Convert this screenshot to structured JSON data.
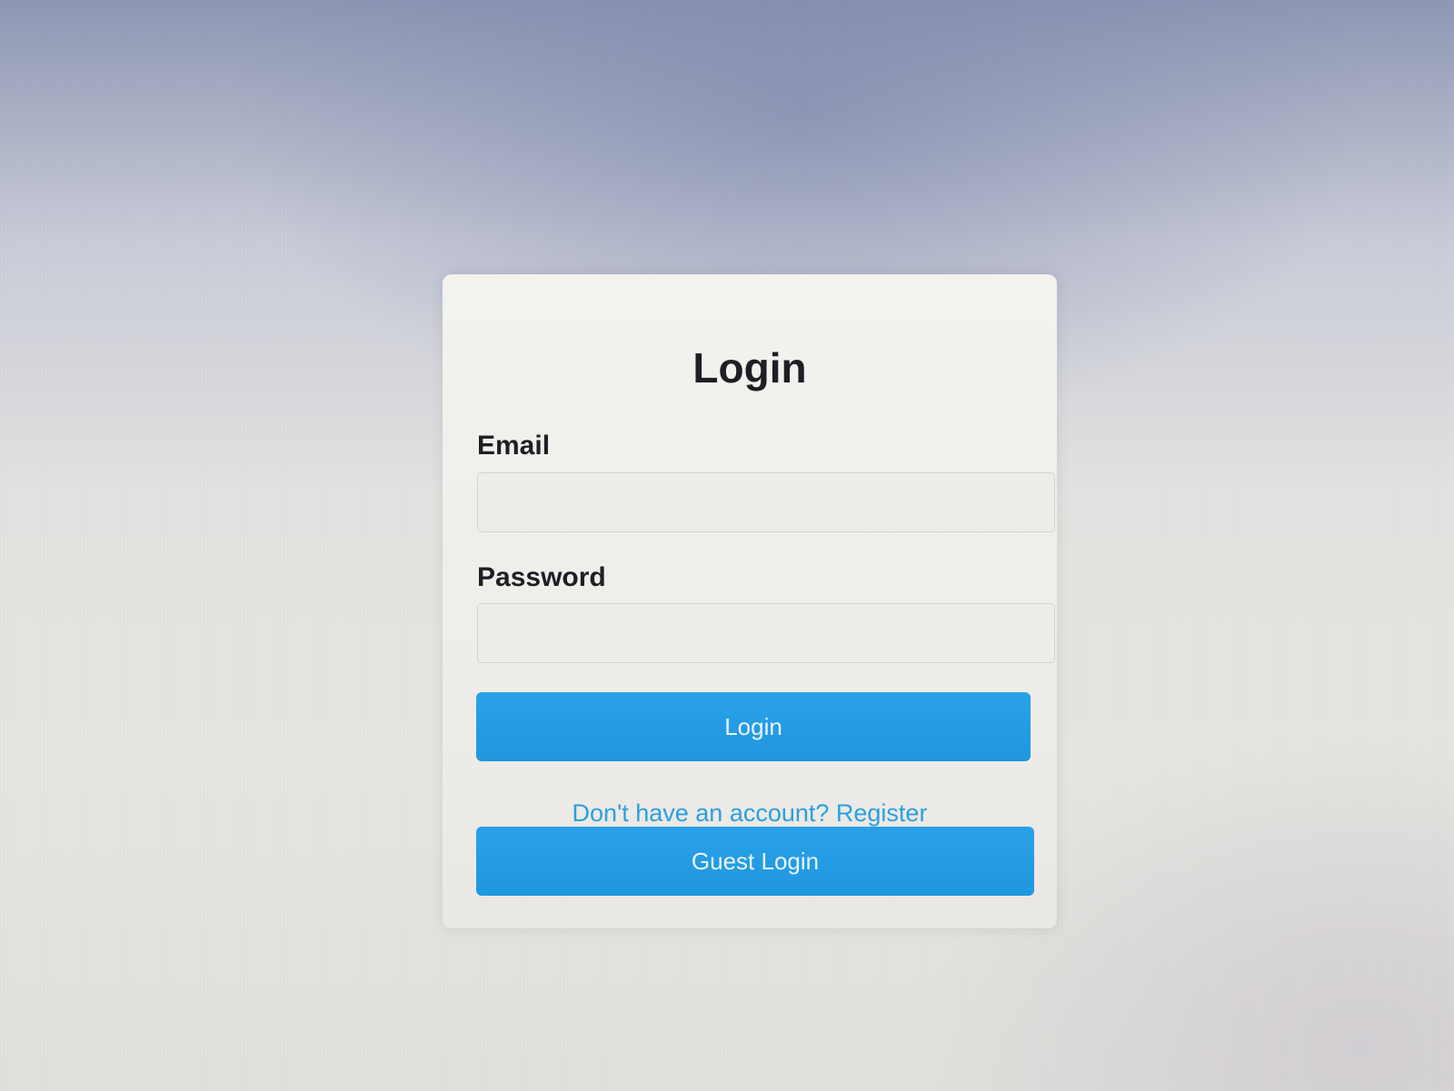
{
  "login_form": {
    "title": "Login",
    "email_label": "Email",
    "email_value": "",
    "password_label": "Password",
    "password_value": "",
    "login_button": "Login",
    "register_link": "Don't have an account? Register",
    "guest_button": "Guest Login"
  },
  "colors": {
    "accent": "#1f97df",
    "link": "#2b9fe0",
    "text": "#1d1f24",
    "card_background": "#f0efeb"
  }
}
